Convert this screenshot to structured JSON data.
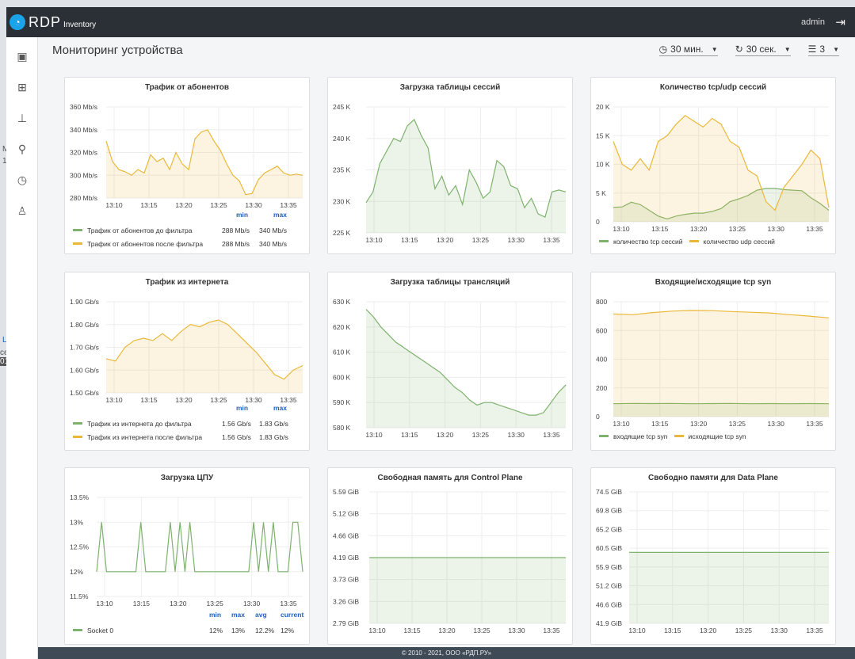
{
  "app": {
    "brand": "RDP",
    "brand_sub": "Inventory",
    "user": "admin"
  },
  "background_fragments": [
    "M",
    "1",
    "L",
    "ce",
    "010"
  ],
  "sidebar": {
    "items": [
      {
        "name": "dashboard-icon",
        "glyph": "▣"
      },
      {
        "name": "grid-icon",
        "glyph": "⊞"
      },
      {
        "name": "router-icon",
        "glyph": "⊥"
      },
      {
        "name": "location-icon",
        "glyph": "⚲"
      },
      {
        "name": "clock-icon",
        "glyph": "◷"
      },
      {
        "name": "user-icon",
        "glyph": "♙"
      }
    ]
  },
  "page": {
    "title": "Мониторинг устройства"
  },
  "controls": {
    "range": "30 мин.",
    "refresh": "30 сек.",
    "columns": "3"
  },
  "footer": "© 2010 - 2021, ООО «РДП.РУ»",
  "colors": {
    "green": "#7eb26d",
    "yellow": "#eab839",
    "blue": "#1f60c4"
  },
  "chart_data": [
    {
      "id": "p1",
      "type": "area",
      "title": "Трафик от абонентов",
      "x_ticks": [
        "13:10",
        "13:15",
        "13:20",
        "13:25",
        "13:30",
        "13:35"
      ],
      "y_ticks": [
        "360 Mb/s",
        "340 Mb/s",
        "320 Mb/s",
        "300 Mb/s",
        "280 Mb/s"
      ],
      "ylim": [
        280,
        360
      ],
      "series": [
        {
          "name": "Трафик от абонентов до фильтра",
          "color": "#7eb26d"
        },
        {
          "name": "Трафик от абонентов после фильтра",
          "color": "#eab839",
          "values": [
            330,
            312,
            305,
            303,
            300,
            305,
            302,
            318,
            312,
            315,
            305,
            320,
            310,
            305,
            332,
            338,
            340,
            330,
            322,
            310,
            300,
            295,
            283,
            284,
            296,
            302,
            305,
            308,
            302,
            300,
            301,
            300
          ]
        }
      ],
      "legend_headers": [
        "min",
        "max"
      ],
      "legend_values": [
        [
          "288 Mb/s",
          "340 Mb/s"
        ],
        [
          "288 Mb/s",
          "340 Mb/s"
        ]
      ]
    },
    {
      "id": "p2",
      "type": "area",
      "title": "Загрузка таблицы сессий",
      "x_ticks": [
        "13:10",
        "13:15",
        "13:20",
        "13:25",
        "13:30",
        "13:35"
      ],
      "y_ticks": [
        "245 K",
        "240 K",
        "235 K",
        "230 K",
        "225 K"
      ],
      "ylim": [
        225,
        245
      ],
      "series": [
        {
          "color": "#7eb26d",
          "values": [
            229.8,
            231.5,
            236,
            238,
            240,
            239.5,
            242,
            243,
            240.5,
            238.5,
            232,
            234,
            231,
            232.5,
            229.5,
            235,
            233,
            230.5,
            231.5,
            236.5,
            235.5,
            232.5,
            232,
            229,
            230.5,
            228,
            227.5,
            231.5,
            231.8,
            231.5
          ]
        }
      ]
    },
    {
      "id": "p3",
      "type": "area",
      "title": "Количество tcp/udp сессий",
      "x_ticks": [
        "13:10",
        "13:15",
        "13:20",
        "13:25",
        "13:30",
        "13:35"
      ],
      "y_ticks": [
        "20 K",
        "15 K",
        "10 K",
        "5 K",
        "0"
      ],
      "ylim": [
        0,
        20
      ],
      "series": [
        {
          "name": "количество tcp сессий",
          "color": "#7eb26d",
          "values": [
            2.5,
            2.6,
            3.4,
            3,
            2,
            1,
            0.5,
            1,
            1.3,
            1.5,
            1.5,
            1.8,
            2.3,
            3.5,
            4,
            4.6,
            5.5,
            5.8,
            5.8,
            5.6,
            5.5,
            5.4,
            4.2,
            3.2,
            2
          ]
        },
        {
          "name": "количество udp сессий",
          "color": "#eab839",
          "values": [
            14,
            10,
            9,
            11,
            9,
            14,
            15,
            17,
            18.5,
            17.5,
            16.5,
            18,
            17,
            14,
            13,
            9,
            8,
            3.5,
            2,
            6,
            8,
            10,
            12.5,
            11,
            2.5
          ]
        }
      ]
    },
    {
      "id": "p4",
      "type": "area",
      "title": "Трафик из интернета",
      "x_ticks": [
        "13:10",
        "13:15",
        "13:20",
        "13:25",
        "13:30",
        "13:35"
      ],
      "y_ticks": [
        "1.90 Gb/s",
        "1.80 Gb/s",
        "1.70 Gb/s",
        "1.60 Gb/s",
        "1.50 Gb/s"
      ],
      "ylim": [
        1.5,
        1.9
      ],
      "series": [
        {
          "name": "Трафик из интернета до фильтра",
          "color": "#7eb26d"
        },
        {
          "name": "Трафик из интернета после фильтра",
          "color": "#eab839",
          "values": [
            1.65,
            1.64,
            1.7,
            1.73,
            1.74,
            1.73,
            1.76,
            1.73,
            1.77,
            1.8,
            1.79,
            1.81,
            1.82,
            1.8,
            1.76,
            1.72,
            1.68,
            1.63,
            1.58,
            1.56,
            1.6,
            1.62
          ]
        }
      ],
      "legend_headers": [
        "min",
        "max"
      ],
      "legend_values": [
        [
          "1.56 Gb/s",
          "1.83 Gb/s"
        ],
        [
          "1.56 Gb/s",
          "1.83 Gb/s"
        ]
      ]
    },
    {
      "id": "p5",
      "type": "area",
      "title": "Загрузка таблицы трансляций",
      "x_ticks": [
        "13:10",
        "13:15",
        "13:20",
        "13:25",
        "13:30",
        "13:35"
      ],
      "y_ticks": [
        "630 K",
        "620 K",
        "610 K",
        "600 K",
        "590 K",
        "580 K"
      ],
      "ylim": [
        580,
        630
      ],
      "series": [
        {
          "color": "#7eb26d",
          "values": [
            627,
            624,
            620,
            617,
            614,
            612,
            610,
            608,
            606,
            604,
            602,
            599,
            596,
            594,
            591,
            589,
            590,
            590,
            589,
            588,
            587,
            586,
            585,
            585,
            586,
            590,
            594,
            597
          ]
        }
      ]
    },
    {
      "id": "p6",
      "type": "area",
      "title": "Входящие/исходящие tcp syn",
      "x_ticks": [
        "13:10",
        "13:15",
        "13:20",
        "13:25",
        "13:30",
        "13:35"
      ],
      "y_ticks": [
        "800",
        "600",
        "400",
        "200",
        "0"
      ],
      "ylim": [
        0,
        800
      ],
      "series": [
        {
          "name": "входящие tcp syn",
          "color": "#7eb26d",
          "values": [
            90,
            92,
            91,
            92,
            90,
            91,
            92,
            90,
            91,
            90,
            91,
            90
          ]
        },
        {
          "name": "исходящие tcp syn",
          "color": "#eab839",
          "values": [
            715,
            710,
            725,
            735,
            740,
            738,
            732,
            727,
            722,
            710,
            700,
            688
          ]
        }
      ]
    },
    {
      "id": "p7",
      "type": "line",
      "title": "Загрузка ЦПУ",
      "x_ticks": [
        "13:10",
        "13:15",
        "13:20",
        "13:25",
        "13:30",
        "13:35"
      ],
      "y_ticks": [
        "13.5%",
        "13%",
        "12.5%",
        "12%",
        "11.5%"
      ],
      "ylim": [
        11.5,
        13.5
      ],
      "series": [
        {
          "name": "Socket 0",
          "color": "#7eb26d",
          "values": [
            12,
            13,
            12,
            12,
            12,
            12,
            12,
            12,
            12,
            13,
            12,
            12,
            12,
            12,
            12,
            13,
            12,
            13,
            12,
            13,
            12,
            12,
            12,
            12,
            12,
            12,
            12,
            12,
            12,
            12,
            12,
            12,
            13,
            12,
            13,
            12,
            13,
            12,
            12,
            12,
            13,
            13,
            12
          ]
        }
      ],
      "legend_headers": [
        "min",
        "max",
        "avg",
        "current"
      ],
      "legend_values": [
        [
          "12%",
          "13%",
          "12.2%",
          "12%"
        ]
      ]
    },
    {
      "id": "p8",
      "type": "area",
      "title": "Свободная память для Control Plane",
      "x_ticks": [
        "13:10",
        "13:15",
        "13:20",
        "13:25",
        "13:30",
        "13:35"
      ],
      "y_ticks": [
        "5.59 GiB",
        "5.12 GiB",
        "4.66 GiB",
        "4.19 GiB",
        "3.73 GiB",
        "3.26 GiB",
        "2.79 GiB"
      ],
      "ylim": [
        2.79,
        5.59
      ],
      "series": [
        {
          "color": "#7eb26d",
          "values": [
            4.19,
            4.19
          ]
        }
      ]
    },
    {
      "id": "p9",
      "type": "area",
      "title": "Свободно памяти для Data Plane",
      "x_ticks": [
        "13:10",
        "13:15",
        "13:20",
        "13:25",
        "13:30",
        "13:35"
      ],
      "y_ticks": [
        "74.5 GiB",
        "69.8 GiB",
        "65.2 GiB",
        "60.5 GiB",
        "55.9 GiB",
        "51.2 GiB",
        "46.6 GiB",
        "41.9 GiB"
      ],
      "ylim": [
        41.9,
        74.5
      ],
      "series": [
        {
          "color": "#7eb26d",
          "values": [
            59.5,
            59.5
          ]
        }
      ]
    }
  ]
}
